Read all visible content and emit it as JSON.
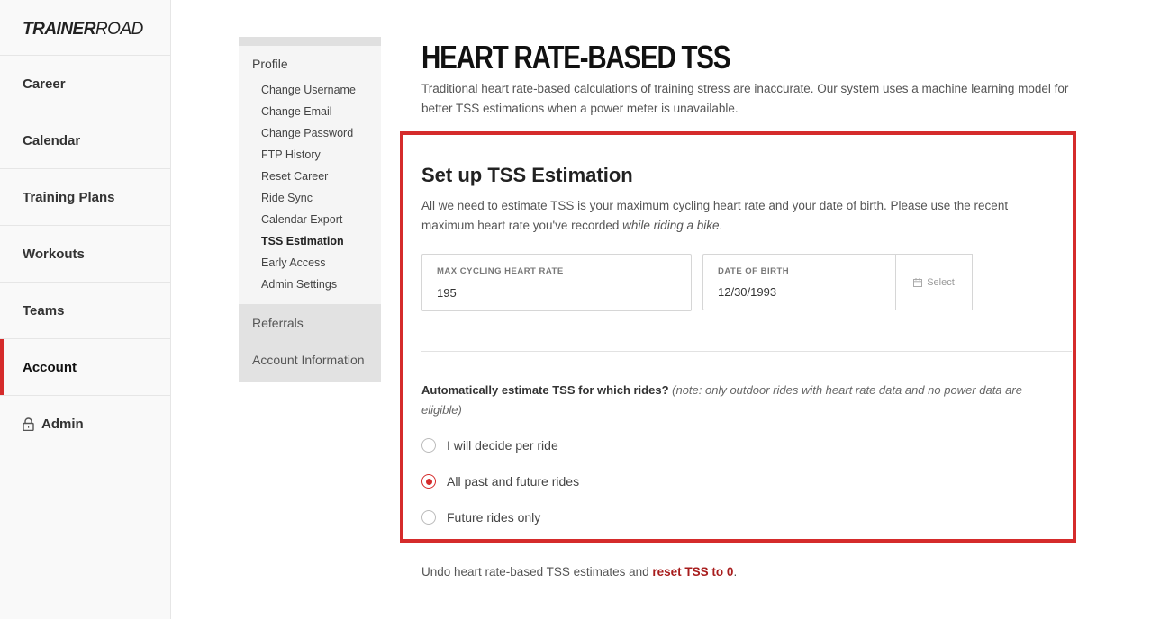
{
  "brand": {
    "logo_bold": "TRAINER",
    "logo_light": "ROAD"
  },
  "sidebar": {
    "items": [
      {
        "label": "Career"
      },
      {
        "label": "Calendar"
      },
      {
        "label": "Training Plans"
      },
      {
        "label": "Workouts"
      },
      {
        "label": "Teams"
      },
      {
        "label": "Account"
      },
      {
        "label": "Admin"
      }
    ]
  },
  "subnav": {
    "profile_heading": "Profile",
    "links": [
      "Change Username",
      "Change Email",
      "Change Password",
      "FTP History",
      "Reset Career",
      "Ride Sync",
      "Calendar Export",
      "TSS Estimation",
      "Early Access",
      "Admin Settings"
    ],
    "referrals": "Referrals",
    "account_information": "Account Information"
  },
  "main": {
    "title": "HEART RATE-BASED TSS",
    "description": "Traditional heart rate-based calculations of training stress are inaccurate. Our system uses a machine learning model for better TSS estimations when a power meter is unavailable."
  },
  "setup": {
    "title": "Set up TSS Estimation",
    "desc_main": "All we need to estimate TSS is your maximum cycling heart rate and your date of birth. Please use the recent maximum heart rate you've recorded ",
    "desc_emph": "while riding a bike",
    "desc_end": ".",
    "max_hr_label": "MAX CYCLING HEART RATE",
    "max_hr_value": "195",
    "dob_label": "DATE OF BIRTH",
    "dob_value": "12/30/1993",
    "select_label": "Select"
  },
  "rides": {
    "question": "Automatically estimate TSS for which rides?",
    "note": "(note: only outdoor rides with heart rate data and no power data are eligible)",
    "options": [
      {
        "label": "I will decide per ride",
        "checked": false
      },
      {
        "label": "All past and future rides",
        "checked": true
      },
      {
        "label": "Future rides only",
        "checked": false
      }
    ]
  },
  "footer": {
    "undo_text": "Undo heart rate-based TSS estimates and ",
    "reset_link": "reset TSS to 0",
    "undo_end": "."
  },
  "colors": {
    "accent": "#d52b2b",
    "link": "#a81d1d"
  }
}
